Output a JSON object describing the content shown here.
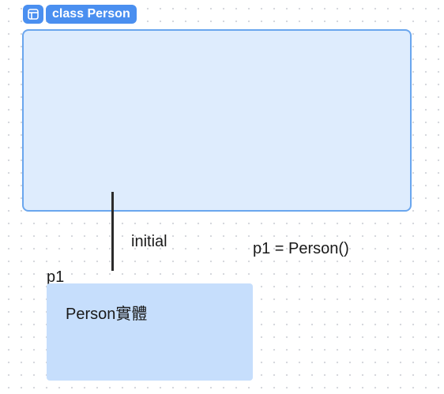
{
  "frame": {
    "icon": "frame-layout-icon",
    "label": "class Person",
    "accent_color": "#4a8ff0",
    "fill_color": "#deecfd",
    "border_color": "#6aa6ee"
  },
  "connector": {
    "label": "initial"
  },
  "assignment": {
    "text": "p1 = Person()"
  },
  "instance": {
    "variable_label": "p1",
    "card_label": "Person實體",
    "fill_color": "#c6defc"
  }
}
